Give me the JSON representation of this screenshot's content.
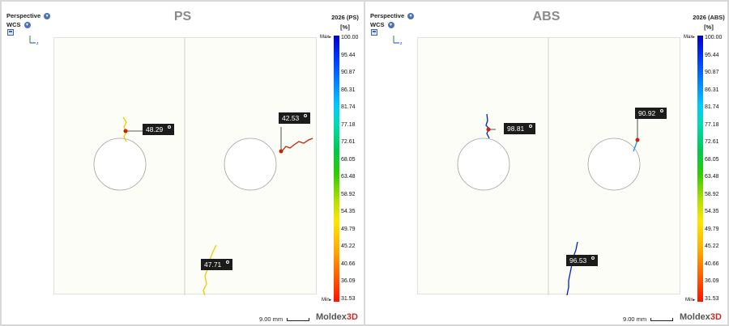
{
  "panels": [
    {
      "title": "PS",
      "projection": "Perspective",
      "coordinate_system": "WCS",
      "colorbar": {
        "title": "2026 (PS)",
        "unit": "[%]",
        "ticks": [
          "100.00",
          "95.44",
          "90.87",
          "86.31",
          "81.74",
          "77.18",
          "72.61",
          "68.05",
          "63.48",
          "58.92",
          "54.35",
          "49.79",
          "45.22",
          "40.66",
          "36.09",
          "31.53"
        ],
        "max_label": "Max",
        "min_label": "Min",
        "max_marker_fraction": 0.0,
        "min_marker_fraction": 1.0
      },
      "labels": [
        "48.29",
        "42.53",
        "47.71"
      ],
      "scale": "9.00 mm",
      "brand": [
        "Moldex",
        "3D"
      ]
    },
    {
      "title": "ABS",
      "projection": "Perspective",
      "coordinate_system": "WCS",
      "colorbar": {
        "title": "2026 (ABS)",
        "unit": "[%]",
        "ticks": [
          "100.00",
          "95.44",
          "90.87",
          "86.31",
          "81.74",
          "77.18",
          "72.61",
          "68.05",
          "63.48",
          "58.92",
          "54.35",
          "49.79",
          "45.22",
          "40.66",
          "36.09",
          "31.53"
        ],
        "max_label": "Max",
        "min_label": "Min",
        "max_marker_fraction": 0.0,
        "min_marker_fraction": 1.0
      },
      "labels": [
        "98.81",
        "90.92",
        "96.53"
      ],
      "scale": "9.00 mm",
      "brand": [
        "Moldex",
        "3D"
      ]
    }
  ],
  "colors": {
    "ps_line_yellow": "#f0c800",
    "ps_line_orange": "#e8a000",
    "ps_line_red": "#cc2200",
    "abs_line_blue": "#0020c8",
    "abs_line_cyan": "#1f8fe8",
    "probe_dot": "#cc2200"
  }
}
